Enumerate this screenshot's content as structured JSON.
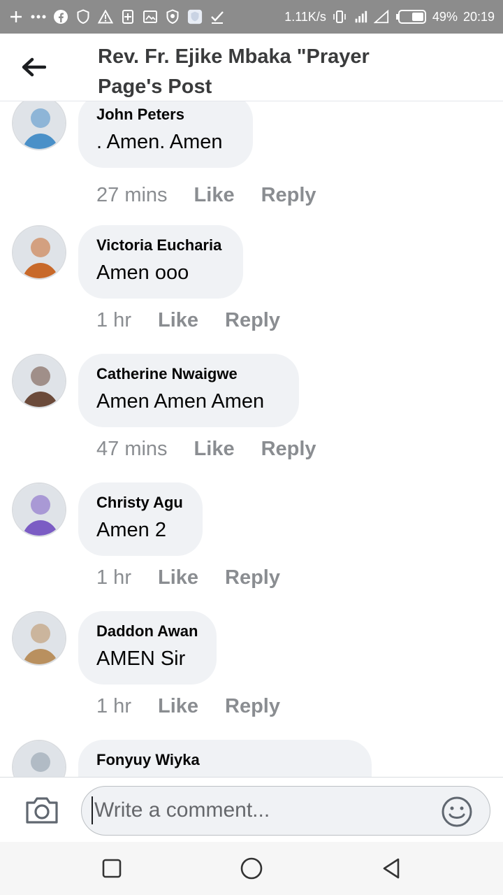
{
  "status_bar": {
    "net_speed": "1.11K/s",
    "battery": "49%",
    "time": "20:19"
  },
  "header": {
    "title": "Rev. Fr. Ejike Mbaka \"Prayer Page's Post"
  },
  "comments": [
    {
      "name": "John Peters",
      "text": ". Amen. Amen",
      "time": "27 mins",
      "like": "Like",
      "reply": "Reply",
      "avatar_color": "#4a90c8",
      "bubble_width": 250
    },
    {
      "name": "Victoria Eucharia",
      "text": "Amen ooo",
      "time": "1 hr",
      "like": "Like",
      "reply": "Reply",
      "avatar_color": "#c8692a",
      "bubble_width": 236
    },
    {
      "name": "Catherine Nwaigwe",
      "text": "Amen Amen Amen",
      "time": "47 mins",
      "like": "Like",
      "reply": "Reply",
      "avatar_color": "#6b4a3a",
      "bubble_width": 316
    },
    {
      "name": "Christy Agu",
      "text": "Amen 2",
      "time": "1 hr",
      "like": "Like",
      "reply": "Reply",
      "avatar_color": "#7b5cc4",
      "bubble_width": 178
    },
    {
      "name": "Daddon Awan",
      "text": "AMEN Sir",
      "time": "1 hr",
      "like": "Like",
      "reply": "Reply",
      "avatar_color": "#b9905f",
      "bubble_width": 198
    },
    {
      "name": "Fonyuy Wiyka",
      "text": "",
      "time": "",
      "like": "",
      "reply": "",
      "avatar_color": "#8a9aa8",
      "bubble_width": 420
    }
  ],
  "composer": {
    "placeholder": "Write a comment..."
  }
}
